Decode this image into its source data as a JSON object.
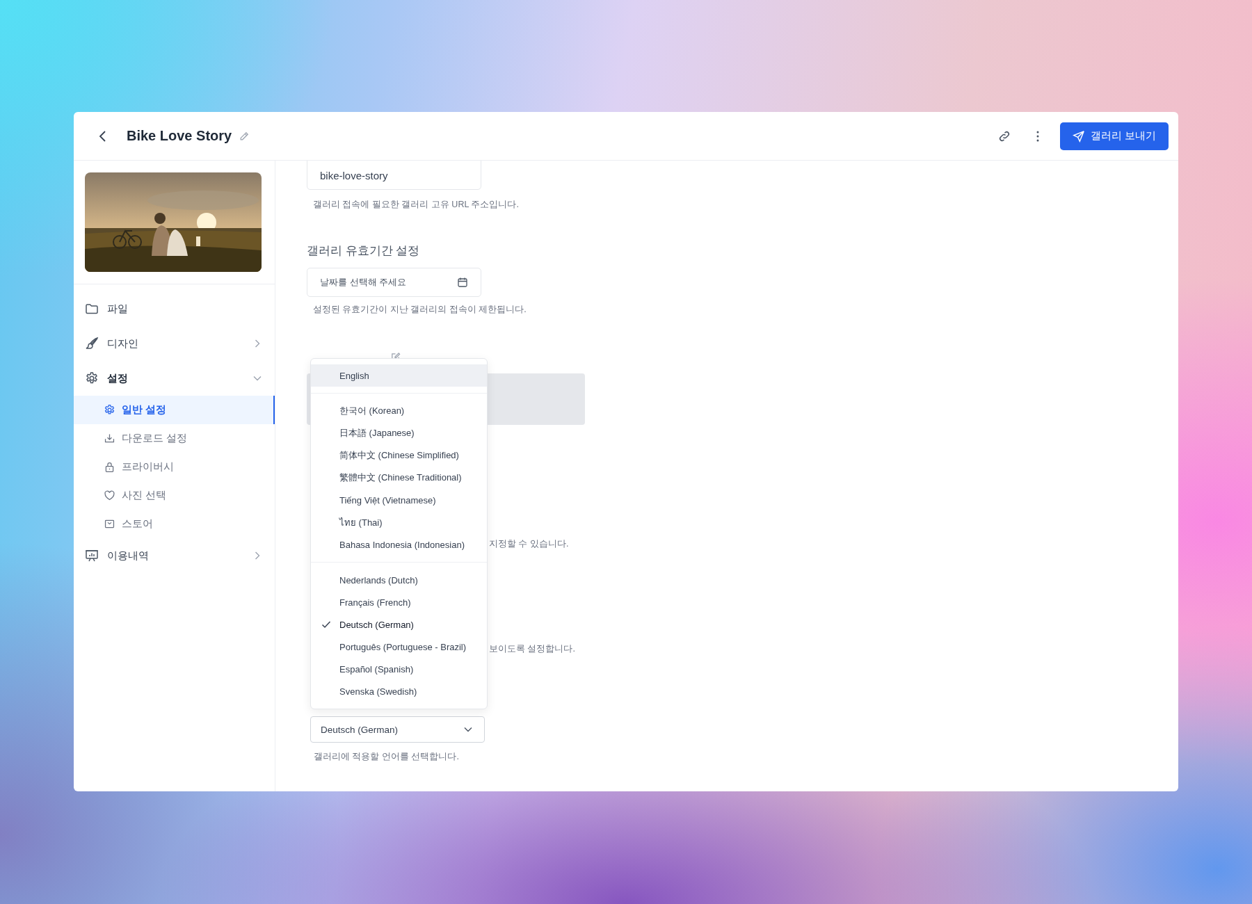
{
  "header": {
    "title": "Bike Love Story",
    "send_button": "갤러리 보내기"
  },
  "sidebar": {
    "items": [
      {
        "label": "파일",
        "selected": false
      },
      {
        "label": "디자인",
        "selected": false,
        "expanded": false
      },
      {
        "label": "설정",
        "selected": false,
        "expanded": true,
        "children": [
          {
            "label": "일반 설정",
            "selected": true
          },
          {
            "label": "다운로드 설정",
            "selected": false
          },
          {
            "label": "프라이버시",
            "selected": false
          },
          {
            "label": "사진 선택",
            "selected": false
          },
          {
            "label": "스토어",
            "selected": false
          }
        ]
      },
      {
        "label": "이용내역",
        "selected": false,
        "expanded": false
      }
    ]
  },
  "content": {
    "url_field": {
      "value": "bike-love-story",
      "help": "갤러리 접속에 필요한 갤러리 고유 URL 주소입니다."
    },
    "expiry": {
      "heading": "갤러리 유효기간 설정",
      "placeholder": "날짜를 선택해 주세요",
      "help": "설정된 유효기간이 지난 갤러리의 접속이 제한됩니다."
    },
    "partial_help_texts": [
      "지정할 수 있습니다.",
      "보이도록 설정합니다."
    ],
    "language": {
      "value": "Deutsch (German)",
      "help": "갤러리에 적용할 언어를 선택합니다.",
      "menu_groups": [
        [
          {
            "label": "English",
            "selected": false,
            "hovered": true
          }
        ],
        [
          {
            "label": "한국어 (Korean)",
            "selected": false,
            "hovered": false
          },
          {
            "label": "日本語 (Japanese)",
            "selected": false,
            "hovered": false
          },
          {
            "label": "简体中文 (Chinese Simplified)",
            "selected": false,
            "hovered": false
          },
          {
            "label": "繁體中文 (Chinese Traditional)",
            "selected": false,
            "hovered": false
          },
          {
            "label": "Tiếng Việt (Vietnamese)",
            "selected": false,
            "hovered": false
          },
          {
            "label": "ไทย (Thai)",
            "selected": false,
            "hovered": false
          },
          {
            "label": "Bahasa Indonesia (Indonesian)",
            "selected": false,
            "hovered": false
          }
        ],
        [
          {
            "label": "Nederlands (Dutch)",
            "selected": false,
            "hovered": false
          },
          {
            "label": "Français (French)",
            "selected": false,
            "hovered": false
          },
          {
            "label": "Deutsch (German)",
            "selected": true,
            "hovered": false
          },
          {
            "label": "Português (Portuguese - Brazil)",
            "selected": false,
            "hovered": false
          },
          {
            "label": "Español (Spanish)",
            "selected": false,
            "hovered": false
          },
          {
            "label": "Svenska (Swedish)",
            "selected": false,
            "hovered": false
          }
        ]
      ]
    }
  }
}
